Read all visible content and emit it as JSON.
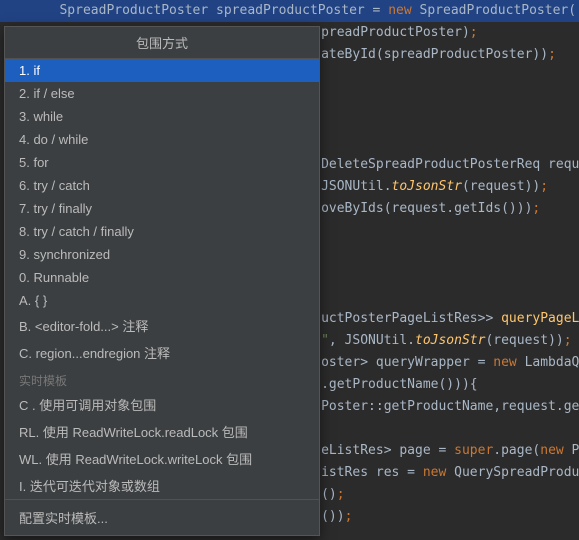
{
  "popup": {
    "title": "包围方式",
    "items": [
      {
        "label": "1. if",
        "selected": true
      },
      {
        "label": "2. if / else"
      },
      {
        "label": "3. while"
      },
      {
        "label": "4. do / while"
      },
      {
        "label": "5. for"
      },
      {
        "label": "6. try / catch"
      },
      {
        "label": "7. try / finally"
      },
      {
        "label": "8. try / catch / finally"
      },
      {
        "label": "9. synchronized"
      },
      {
        "label": "0. Runnable"
      },
      {
        "label": "A. { }"
      },
      {
        "label": "B. <editor-fold...> 注释"
      },
      {
        "label": "C. region...endregion 注释"
      }
    ],
    "section_header": "实时模板",
    "live_templates": [
      {
        "label": "C . 使用可调用对象包围"
      },
      {
        "label": "RL. 使用 ReadWriteLock.readLock 包围"
      },
      {
        "label": "WL. 使用 ReadWriteLock.writeLock 包围"
      },
      {
        "label": "I. 迭代可迭代对象或数组"
      }
    ],
    "footer": "配置实时模板..."
  },
  "code": {
    "line1_a": "SpreadProductPoster spreadProductPoster = ",
    "line1_new": "new",
    "line1_b": " SpreadProductPoster(",
    "line2_a": "preadProductPoster)",
    "line2_semi": ";",
    "line3_a": "ateById(spreadProductPoster))",
    "line3_semi": ";",
    "line7_a": "DeleteSpreadProductPosterReq requ",
    "line8_a": "JSONUtil.",
    "line8_tojson": "toJsonStr",
    "line8_b": "(request))",
    "line8_semi": ";",
    "line9_a": "oveByIds(request.getIds()))",
    "line9_semi": ";",
    "line14_a": "uctPosterPageListRes>> ",
    "line14_method": "queryPageL",
    "line15_str": "\"",
    "line15_a": ", JSONUtil.",
    "line15_tojson": "toJsonStr",
    "line15_b": "(request))",
    "line15_semi": ";",
    "line16_a": "oster> queryWrapper = ",
    "line16_new": "new",
    "line16_b": " LambdaQ",
    "line17_a": ".getProductName())){",
    "line18_a": "Poster::getProductName,request.ge",
    "line20_a": "eListRes> page = ",
    "line20_super": "super",
    "line20_b": ".page(",
    "line20_new": "new",
    "line20_c": " P",
    "line21_a": "istRes res = ",
    "line21_new": "new",
    "line21_b": " QuerySpreadProdu",
    "line22_a": "()",
    "line22_semi": ";",
    "line23_a": "())",
    "line23_semi": ";"
  }
}
